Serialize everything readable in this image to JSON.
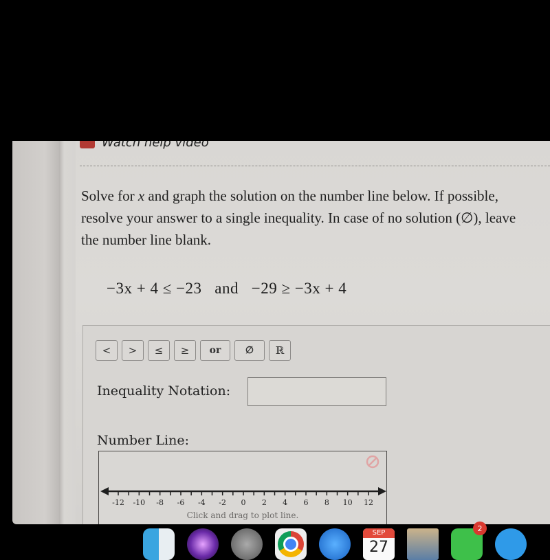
{
  "help": {
    "label": "Watch help video",
    "icon": "video-play-icon"
  },
  "question": {
    "prompt_part1": "Solve for ",
    "variable": "x",
    "prompt_part2": " and graph the solution on the number line below. If possible, resolve your answer to a single inequality. In case of no solution (∅), leave the number line blank.",
    "equation": "−3x + 4 ≤ −23   and   −29 ≥ −3x + 4"
  },
  "symbol_buttons": [
    {
      "label": "<",
      "name": "less-than"
    },
    {
      "label": ">",
      "name": "greater-than"
    },
    {
      "label": "≤",
      "name": "less-equal"
    },
    {
      "label": "≥",
      "name": "greater-equal"
    },
    {
      "label": "or",
      "name": "or"
    },
    {
      "label": "∅",
      "name": "empty-set"
    },
    {
      "label": "ℝ",
      "name": "all-reals"
    }
  ],
  "inequality": {
    "label": "Inequality Notation:",
    "value": "",
    "placeholder": ""
  },
  "number_line": {
    "label": "Number Line:",
    "hint": "Click and drag to plot line.",
    "min": -12,
    "max": 12,
    "tick_step": 1,
    "label_step": 2,
    "tick_labels": [
      "-12",
      "-10",
      "-8",
      "-6",
      "-4",
      "-2",
      "0",
      "2",
      "4",
      "6",
      "8",
      "10",
      "12"
    ],
    "clear_icon": "no-entry-icon",
    "clear_icon_color": "#e0a5a5"
  },
  "dock": {
    "items": [
      {
        "name": "finder"
      },
      {
        "name": "siri"
      },
      {
        "name": "launchpad"
      },
      {
        "name": "chrome"
      },
      {
        "name": "safari"
      },
      {
        "name": "calendar",
        "month": "SEP",
        "day": "27"
      },
      {
        "name": "preview"
      },
      {
        "name": "facetime",
        "badge": "2"
      },
      {
        "name": "messages"
      }
    ]
  }
}
